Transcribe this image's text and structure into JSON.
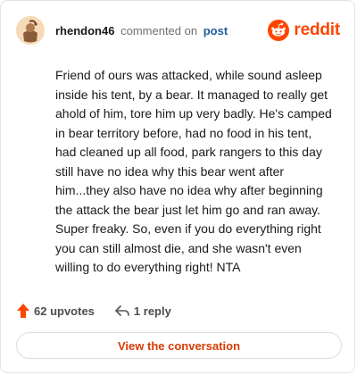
{
  "header": {
    "username": "rhendon46",
    "commented_on": "commented on",
    "post_link": "post",
    "brand": "reddit"
  },
  "comment": {
    "text": "Friend of ours was attacked, while sound asleep inside his tent, by a bear. It managed to really get ahold of him, tore him up very badly. He's camped in bear territory before, had no food in his tent, had cleaned up all food, park rangers to this day still have no idea why this bear went after him...they also have no idea why after beginning the attack the bear just let him go and ran away. Super freaky. So, even if you do everything right you can still almost die, and she wasn't even willing to do everything right! NTA"
  },
  "actions": {
    "upvotes": "62 upvotes",
    "replies": "1 reply"
  },
  "cta": {
    "label": "View the conversation"
  },
  "colors": {
    "brand": "#ff4500",
    "link": "#1f5e9e",
    "cta_text": "#d93a00"
  },
  "icons": [
    "avatar-icon",
    "reddit-logo-icon",
    "upvote-arrow-icon",
    "reply-icon"
  ]
}
